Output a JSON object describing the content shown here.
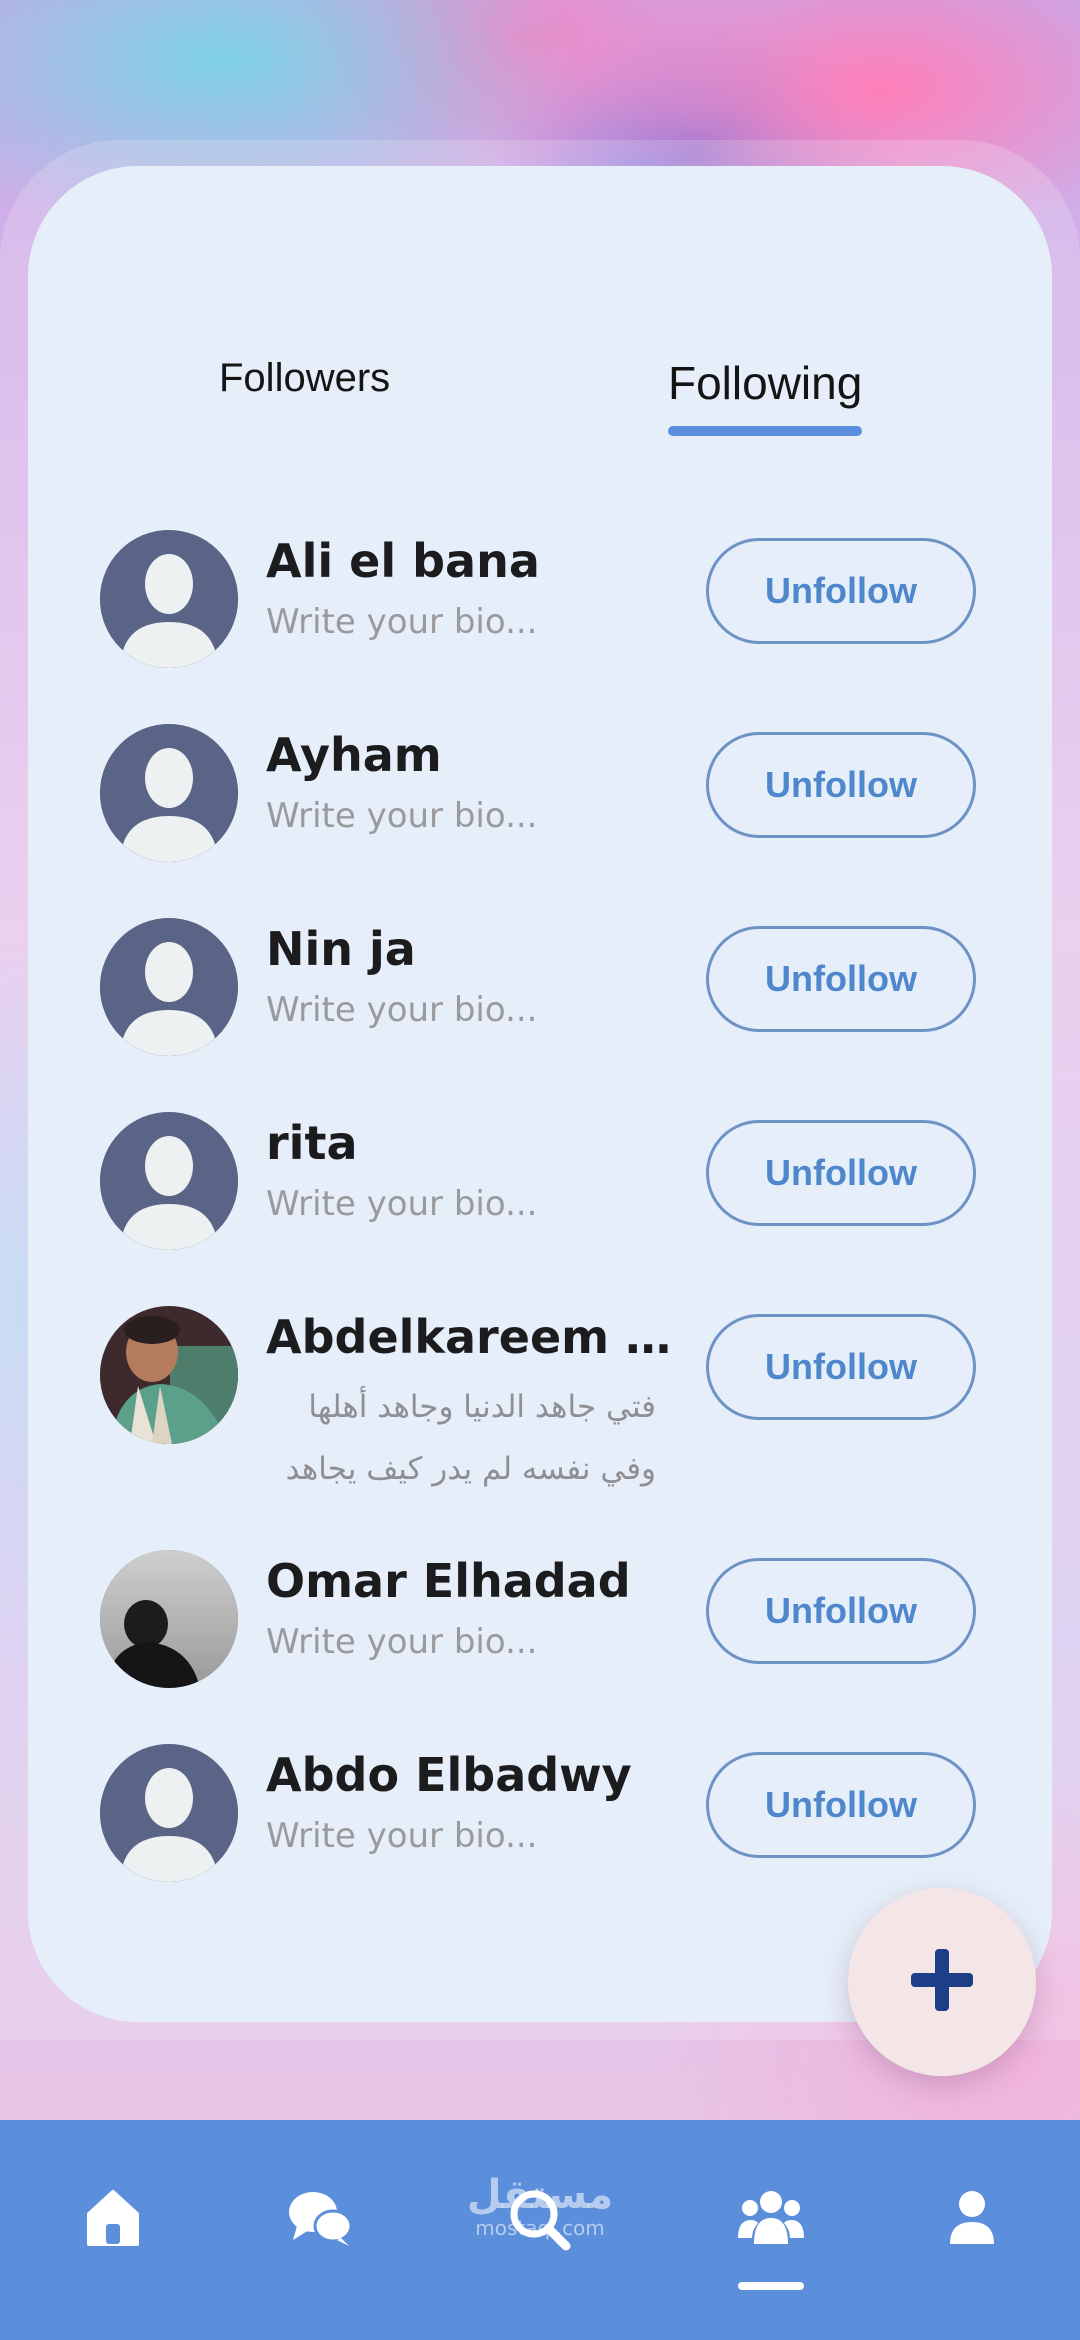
{
  "tabs": [
    {
      "label": "Followers",
      "active": false
    },
    {
      "label": "Following",
      "active": true
    }
  ],
  "following": [
    {
      "name": "Ali el bana",
      "bio": "Write your bio...",
      "button": "Unfollow",
      "avatar": "default-avatar"
    },
    {
      "name": "Ayham",
      "bio": "Write your bio...",
      "button": "Unfollow",
      "avatar": "default-avatar"
    },
    {
      "name": "Nin ja",
      "bio": "Write your bio...",
      "button": "Unfollow",
      "avatar": "default-avatar"
    },
    {
      "name": "rita",
      "bio": "Write your bio...",
      "button": "Unfollow",
      "avatar": "default-avatar"
    },
    {
      "name": "Abdelkareem El...",
      "bio_lines": [
        "فتي جاهد الدنيا وجاهد أهلها",
        "وفي نفسه لم يدر كيف يجاهد"
      ],
      "button": "Unfollow",
      "avatar": "photo"
    },
    {
      "name": "Omar Elhadad",
      "bio": "Write your bio...",
      "button": "Unfollow",
      "avatar": "photo-dark"
    },
    {
      "name": "Abdo Elbadwy",
      "bio": "Write your bio...",
      "button": "Unfollow",
      "avatar": "default-avatar"
    }
  ],
  "fab": {
    "icon": "plus-icon"
  },
  "bottom_nav": {
    "items": [
      {
        "icon": "home-icon"
      },
      {
        "icon": "chat-icon"
      },
      {
        "icon": "search-icon"
      },
      {
        "icon": "group-icon",
        "active": true
      },
      {
        "icon": "profile-icon"
      }
    ]
  },
  "watermark": {
    "arabic": "مستقل",
    "latin": "mostaql.com"
  },
  "colors": {
    "accent": "#5b8ede",
    "card": "#e6eef9",
    "button_text": "#4f87cc",
    "nav": "#5b8edb",
    "fab_bg": "#f4e5e6",
    "fab_icon": "#1d3f87"
  }
}
